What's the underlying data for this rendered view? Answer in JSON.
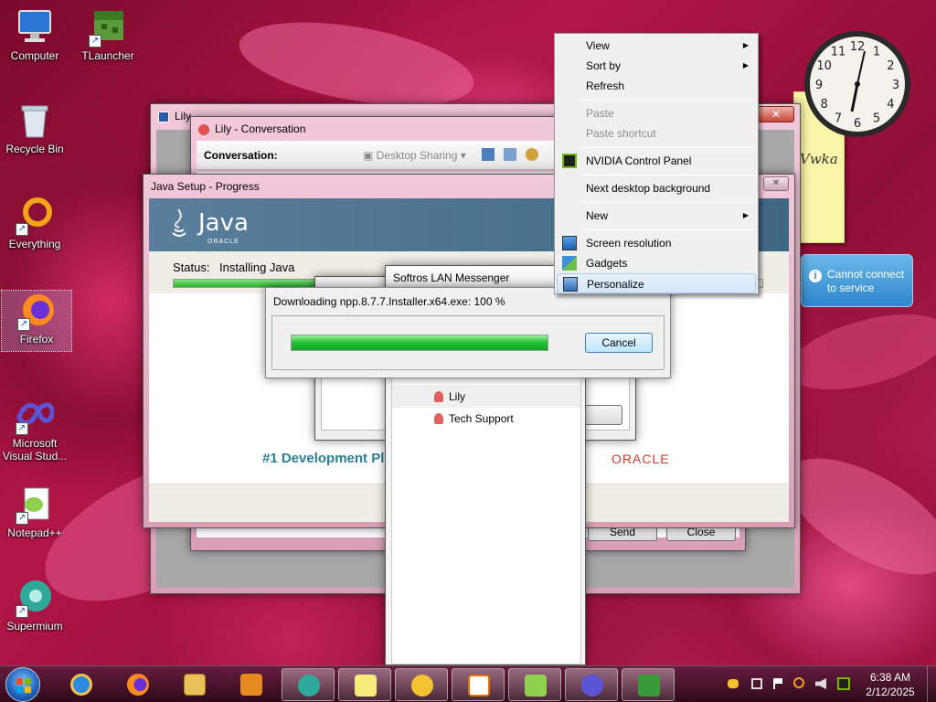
{
  "desktop_icons": [
    {
      "label": "Computer"
    },
    {
      "label": "TLauncher"
    },
    {
      "label": "Recycle Bin"
    },
    {
      "label": "Everything"
    },
    {
      "label": "Firefox"
    },
    {
      "label": "Microsoft Visual Stud..."
    },
    {
      "label": "Notepad++"
    },
    {
      "label": "Supermium"
    }
  ],
  "lily_window": {
    "title": "Lily"
  },
  "conversation_window": {
    "title": "Lily - Conversation",
    "toolbar_label": "Conversation:",
    "desktop_sharing": "Desktop Sharing",
    "send": "Send",
    "close": "Close"
  },
  "java_setup": {
    "title": "Java Setup - Progress",
    "brand": "Java",
    "oracle_small": "ORACLE",
    "status_label": "Status:",
    "status_value": "Installing Java",
    "tagline": "#1 Development Pl",
    "oracle": "ORACLE",
    "progress": 0.9
  },
  "softros": {
    "title": "Softros LAN Messenger",
    "contacts": [
      "Lily",
      "Tech Support"
    ]
  },
  "download_dialog": {
    "text": "Downloading npp.8.7.7.Installer.x64.exe: 100 %",
    "progress": 100,
    "cancel": "Cancel"
  },
  "context_menu": {
    "items": {
      "view": "View",
      "sort_by": "Sort by",
      "refresh": "Refresh",
      "paste": "Paste",
      "paste_shortcut": "Paste shortcut",
      "nvidia": "NVIDIA Control Panel",
      "next_bg": "Next desktop background",
      "new": "New",
      "screen_resolution": "Screen resolution",
      "gadgets": "Gadgets",
      "personalize": "Personalize"
    }
  },
  "sticky_note": {
    "text": "Vwka"
  },
  "weather_gadget": {
    "text": "Cannot connect to service"
  },
  "clock": {
    "numbers": [
      "12",
      "1",
      "2",
      "3",
      "4",
      "5",
      "6",
      "7",
      "8",
      "9",
      "10",
      "11"
    ]
  },
  "tray": {
    "time": "6:38 AM",
    "date": "2/12/2025"
  }
}
